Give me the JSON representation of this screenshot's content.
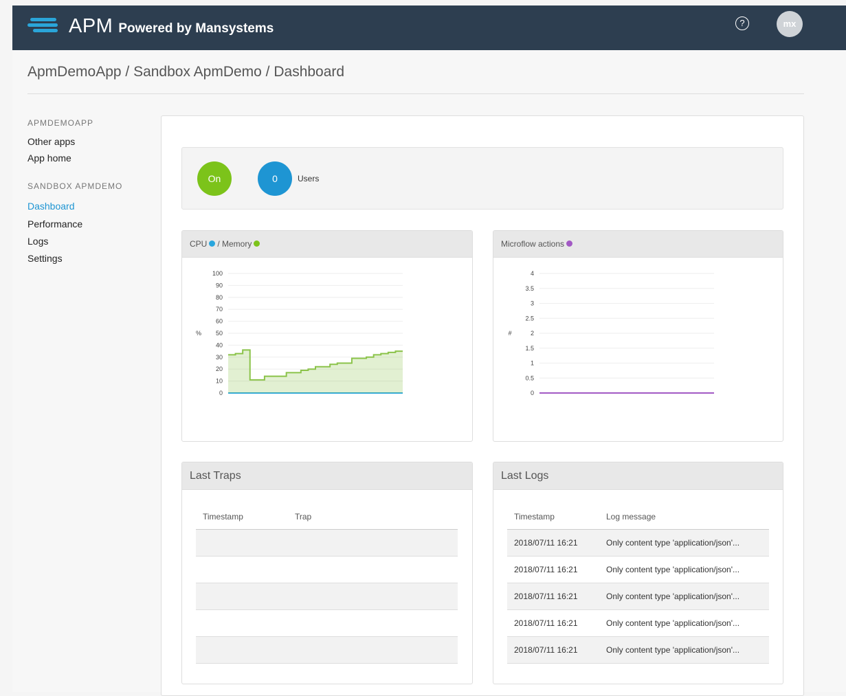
{
  "header": {
    "brand": "APM",
    "powered": "Powered by Mansystems",
    "avatar_initials": "mx",
    "help_symbol": "?"
  },
  "breadcrumb": "ApmDemoApp / Sandbox ApmDemo / Dashboard",
  "sidebar": {
    "section1": "APMDEMOAPP",
    "section1_items": [
      "Other apps",
      "App home"
    ],
    "section2": "SANDBOX APMDEMO",
    "section2_items": [
      "Dashboard",
      "Performance",
      "Logs",
      "Settings"
    ],
    "active": "Dashboard"
  },
  "status": {
    "state": "On",
    "users_count": "0",
    "users_label": "Users"
  },
  "colors": {
    "header": "#2d3e50",
    "accent": "#1e95d3",
    "on": "#7cc31a",
    "users": "#1e95d3",
    "memory": "#8bc34a",
    "cpu": "#29a6dd",
    "microflow": "#a259c4"
  },
  "cpu_chart": {
    "title_a": "CPU",
    "title_b": "/ Memory",
    "ylabel": "%"
  },
  "microflow_chart": {
    "title": "Microflow actions",
    "ylabel": "#"
  },
  "chart_data": [
    {
      "type": "area",
      "title": "CPU / Memory",
      "ylabel": "%",
      "ylim": [
        0,
        100
      ],
      "yticks": [
        0,
        10,
        20,
        30,
        40,
        50,
        60,
        70,
        80,
        90,
        100
      ],
      "series": [
        {
          "name": "CPU",
          "values": [
            0,
            0,
            0,
            0,
            0,
            0,
            0,
            0,
            0,
            0,
            0,
            0,
            0,
            0,
            0,
            0,
            0,
            0,
            0,
            0,
            0,
            0,
            0,
            0,
            0
          ]
        },
        {
          "name": "Memory",
          "values": [
            32,
            33,
            36,
            11,
            11,
            14,
            14,
            14,
            17,
            17,
            19,
            20,
            22,
            22,
            24,
            25,
            25,
            29,
            29,
            30,
            32,
            33,
            34,
            35,
            35
          ]
        }
      ],
      "grid": true
    },
    {
      "type": "line",
      "title": "Microflow actions",
      "ylabel": "#",
      "ylim": [
        0,
        4
      ],
      "yticks": [
        0,
        0.5,
        1,
        1.5,
        2,
        2.5,
        3,
        3.5,
        4
      ],
      "series": [
        {
          "name": "Microflow actions",
          "values": [
            0,
            0,
            0,
            0,
            0,
            0,
            0,
            0,
            0,
            0
          ]
        }
      ],
      "grid": true
    }
  ],
  "traps": {
    "title": "Last Traps",
    "col1": "Timestamp",
    "col2": "Trap",
    "rows": [
      [
        "",
        ""
      ],
      [
        "",
        ""
      ],
      [
        "",
        ""
      ],
      [
        "",
        ""
      ],
      [
        "",
        ""
      ]
    ]
  },
  "logs": {
    "title": "Last Logs",
    "col1": "Timestamp",
    "col2": "Log message",
    "rows": [
      [
        "2018/07/11 16:21",
        "Only content type 'application/json'..."
      ],
      [
        "2018/07/11 16:21",
        "Only content type 'application/json'..."
      ],
      [
        "2018/07/11 16:21",
        "Only content type 'application/json'..."
      ],
      [
        "2018/07/11 16:21",
        "Only content type 'application/json'..."
      ],
      [
        "2018/07/11 16:21",
        "Only content type 'application/json'..."
      ]
    ]
  }
}
